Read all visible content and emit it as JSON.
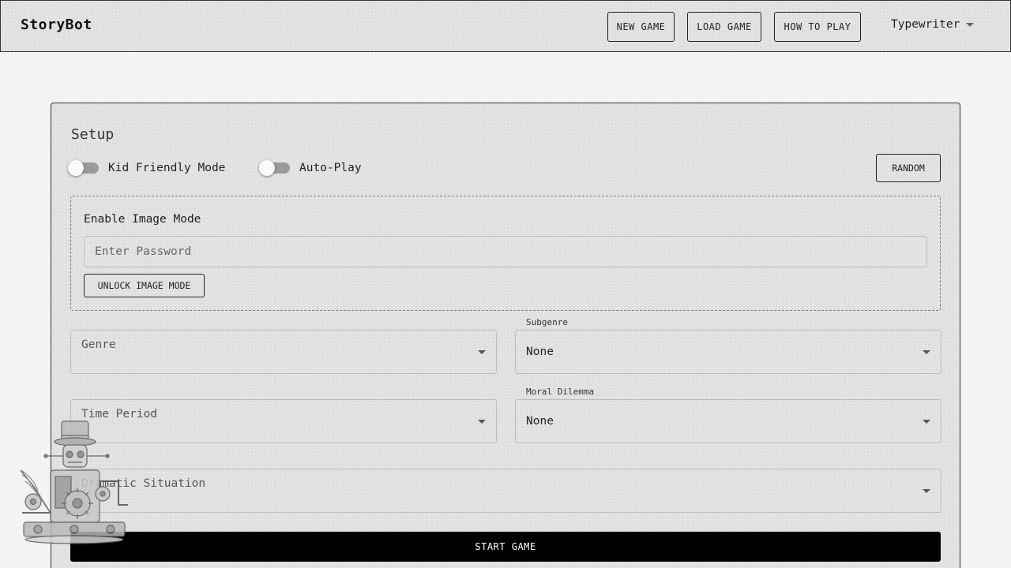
{
  "app": {
    "brand": "StoryBot"
  },
  "header": {
    "nav": {
      "new_game": "NEW GAME",
      "load_game": "LOAD GAME",
      "how_to_play": "HOW TO PLAY"
    },
    "theme": {
      "selected": "Typewriter",
      "icon": "chevron-down-icon"
    }
  },
  "setup": {
    "title": "Setup",
    "toggles": {
      "kid_friendly": {
        "label": "Kid Friendly Mode",
        "checked": false
      },
      "auto_play": {
        "label": "Auto-Play",
        "checked": false
      }
    },
    "random_label": "RANDOM",
    "image_mode": {
      "title": "Enable Image Mode",
      "password_placeholder": "Enter Password",
      "password_value": "",
      "unlock_label": "UNLOCK IMAGE MODE"
    },
    "fields": {
      "genre": {
        "placeholder": "Genre",
        "value": ""
      },
      "subgenre": {
        "label": "Subgenre",
        "value": "None"
      },
      "time_period": {
        "placeholder": "Time Period",
        "value": ""
      },
      "moral_dilemma": {
        "label": "Moral Dilemma",
        "value": "None"
      },
      "dramatic_situation": {
        "placeholder": "Dramatic Situation",
        "value": ""
      }
    },
    "start_label": "START GAME"
  },
  "colors": {
    "page_bg": "#f3f3f3",
    "paper": "#e2e2e2",
    "border": "#333333",
    "start_button": "#000000"
  }
}
